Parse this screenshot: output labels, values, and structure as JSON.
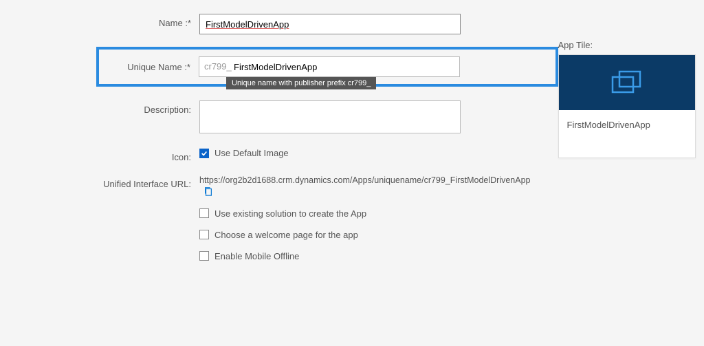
{
  "labels": {
    "name": "Name :*",
    "uniqueName": "Unique Name :*",
    "description": "Description:",
    "icon": "Icon:",
    "url": "Unified Interface URL:",
    "appTile": "App Tile:"
  },
  "fields": {
    "name": "FirstModelDrivenApp",
    "uniqueNamePrefix": "cr799_",
    "uniqueNameValue": "FirstModelDrivenApp",
    "description": "",
    "useDefaultImage": "Use Default Image",
    "urlValue": "https://org2b2d1688.crm.dynamics.com/Apps/uniquename/cr799_FirstModelDrivenApp",
    "tooltip": "Unique name with publisher prefix cr799_"
  },
  "options": {
    "useExisting": "Use existing solution to create the App",
    "welcome": "Choose a welcome page for the app",
    "offline": "Enable Mobile Offline"
  },
  "tile": {
    "title": "FirstModelDrivenApp"
  }
}
